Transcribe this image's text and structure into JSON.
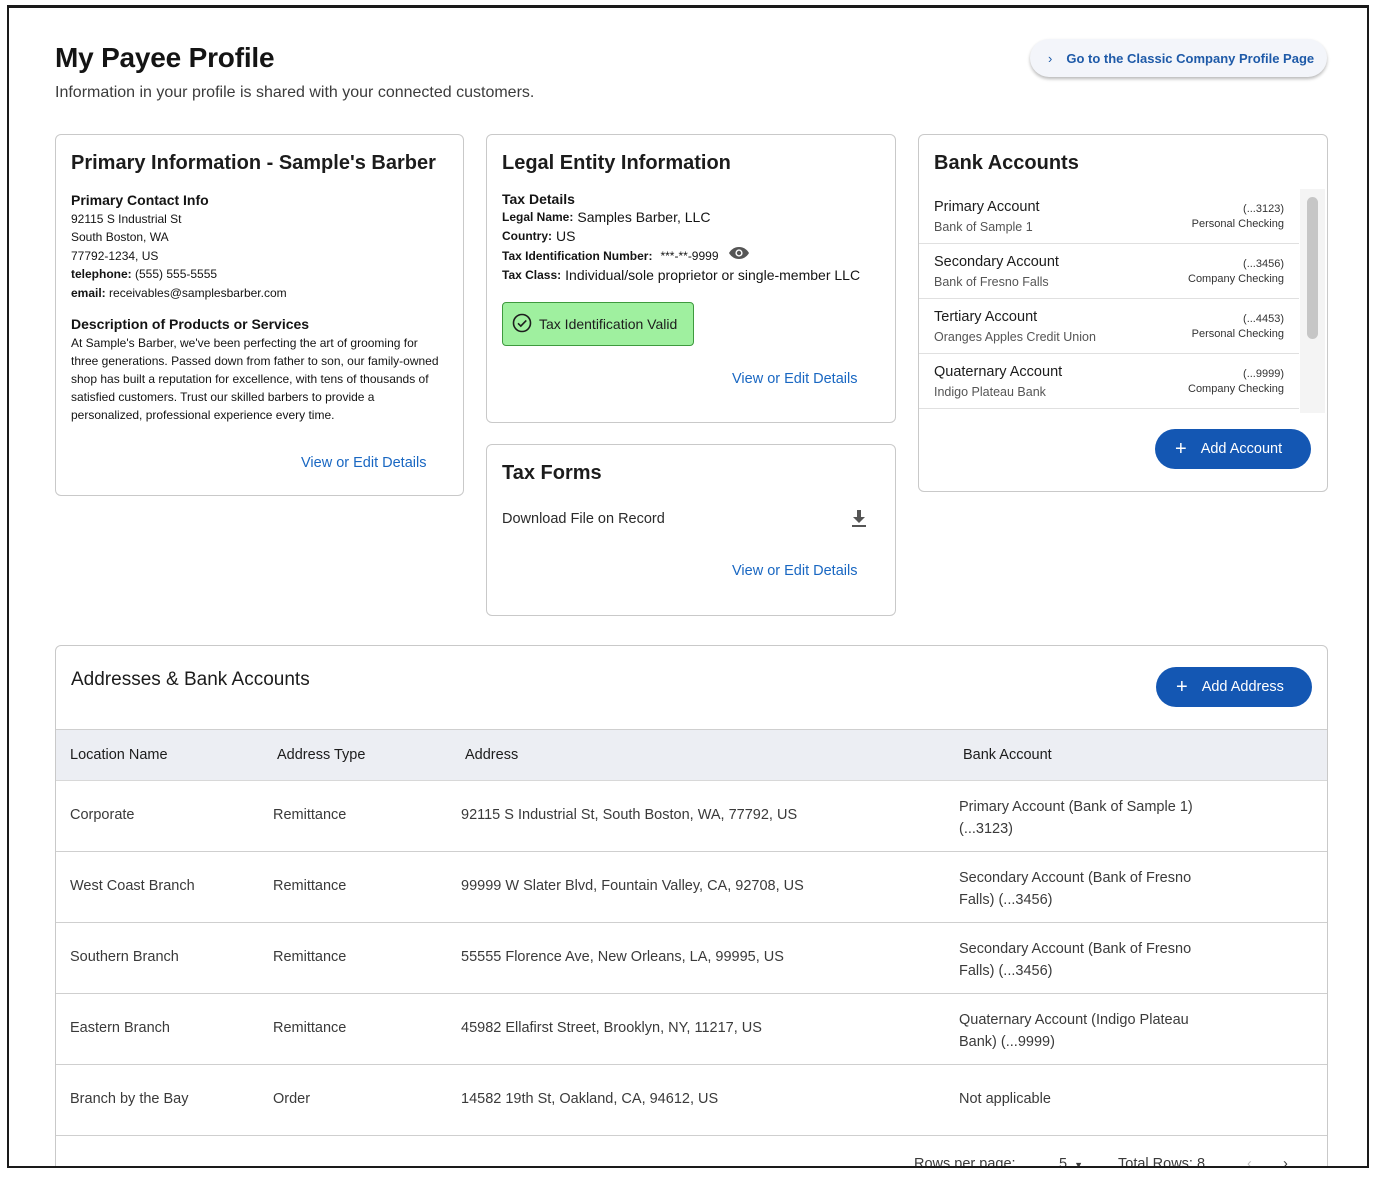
{
  "header": {
    "title": "My Payee Profile",
    "subtitle": "Information in your profile is shared with your connected customers.",
    "classic_link": "Go to the Classic Company Profile Page"
  },
  "primary": {
    "title": "Primary Information - Sample's Barber",
    "contact_heading": "Primary Contact Info",
    "street": "92115 S Industrial St",
    "city": "South Boston, WA",
    "zip": "77792-1234, US",
    "telephone_label": "telephone:",
    "telephone": "(555) 555-5555",
    "email_label": "email:",
    "email": "receivables@samplesbarber.com",
    "desc_heading": "Description of Products or Services",
    "description": "At Sample's Barber, we've been perfecting the art of grooming for three generations. Passed down from father to son, our family-owned shop has built a reputation for excellence, with tens of thousands of satisfied customers. Trust our skilled barbers to provide a personalized, professional experience every time.",
    "link": "View or Edit Details"
  },
  "legal": {
    "title": "Legal Entity Information",
    "tax_heading": "Tax Details",
    "legal_name_label": "Legal Name:",
    "legal_name": "Samples Barber, LLC",
    "country_label": "Country:",
    "country": "US",
    "tin_label": "Tax Identification Number:",
    "tin": "***-**-9999",
    "tax_class_label": "Tax Class:",
    "tax_class": "Individual/sole proprietor or single-member LLC",
    "valid_badge": "Tax Identification Valid",
    "link": "View or Edit Details"
  },
  "tax_forms": {
    "title": "Tax Forms",
    "download_label": "Download File on Record",
    "link": "View or Edit Details"
  },
  "bank_accounts": {
    "title": "Bank Accounts",
    "items": [
      {
        "name": "Primary Account",
        "bank": "Bank of Sample 1",
        "number": "(...3123)",
        "type": "Personal Checking"
      },
      {
        "name": "Secondary Account",
        "bank": "Bank of Fresno Falls",
        "number": "(...3456)",
        "type": "Company Checking"
      },
      {
        "name": "Tertiary Account",
        "bank": "Oranges Apples Credit Union",
        "number": "(...4453)",
        "type": "Personal Checking"
      },
      {
        "name": "Quaternary Account",
        "bank": "Indigo Plateau Bank",
        "number": "(...9999)",
        "type": "Company Checking"
      }
    ],
    "add_button": "Add Account"
  },
  "addresses": {
    "title": "Addresses & Bank Accounts",
    "add_button": "Add Address",
    "columns": [
      "Location Name",
      "Address Type",
      "Address",
      "Bank Account"
    ],
    "rows": [
      {
        "location": "Corporate",
        "type": "Remittance",
        "address": "92115 S Industrial St, South Boston, WA, 77792, US",
        "bank": "Primary Account (Bank of Sample 1) (...3123)"
      },
      {
        "location": "West Coast Branch",
        "type": "Remittance",
        "address": "99999 W Slater Blvd, Fountain Valley, CA, 92708, US",
        "bank": "Secondary Account (Bank of Fresno Falls) (...3456)"
      },
      {
        "location": "Southern Branch",
        "type": "Remittance",
        "address": "55555 Florence Ave, New Orleans, LA, 99995, US",
        "bank": "Secondary Account (Bank of Fresno Falls) (...3456)"
      },
      {
        "location": "Eastern Branch",
        "type": "Remittance",
        "address": "45982 Ellafirst Street, Brooklyn, NY, 11217, US",
        "bank": "Quaternary Account (Indigo Plateau Bank) (...9999)"
      },
      {
        "location": "Branch by the Bay",
        "type": "Order",
        "address": "14582 19th St, Oakland, CA, 94612, US",
        "bank": "Not applicable"
      }
    ],
    "pagination": {
      "rows_per_page_label": "Rows per page:",
      "rows_per_page": "5",
      "total_rows": "Total Rows: 8"
    }
  },
  "colors": {
    "link": "#1967c2",
    "primary_button": "#1457b3",
    "valid_badge": "#9ff09f",
    "table_header": "#eceef3"
  }
}
